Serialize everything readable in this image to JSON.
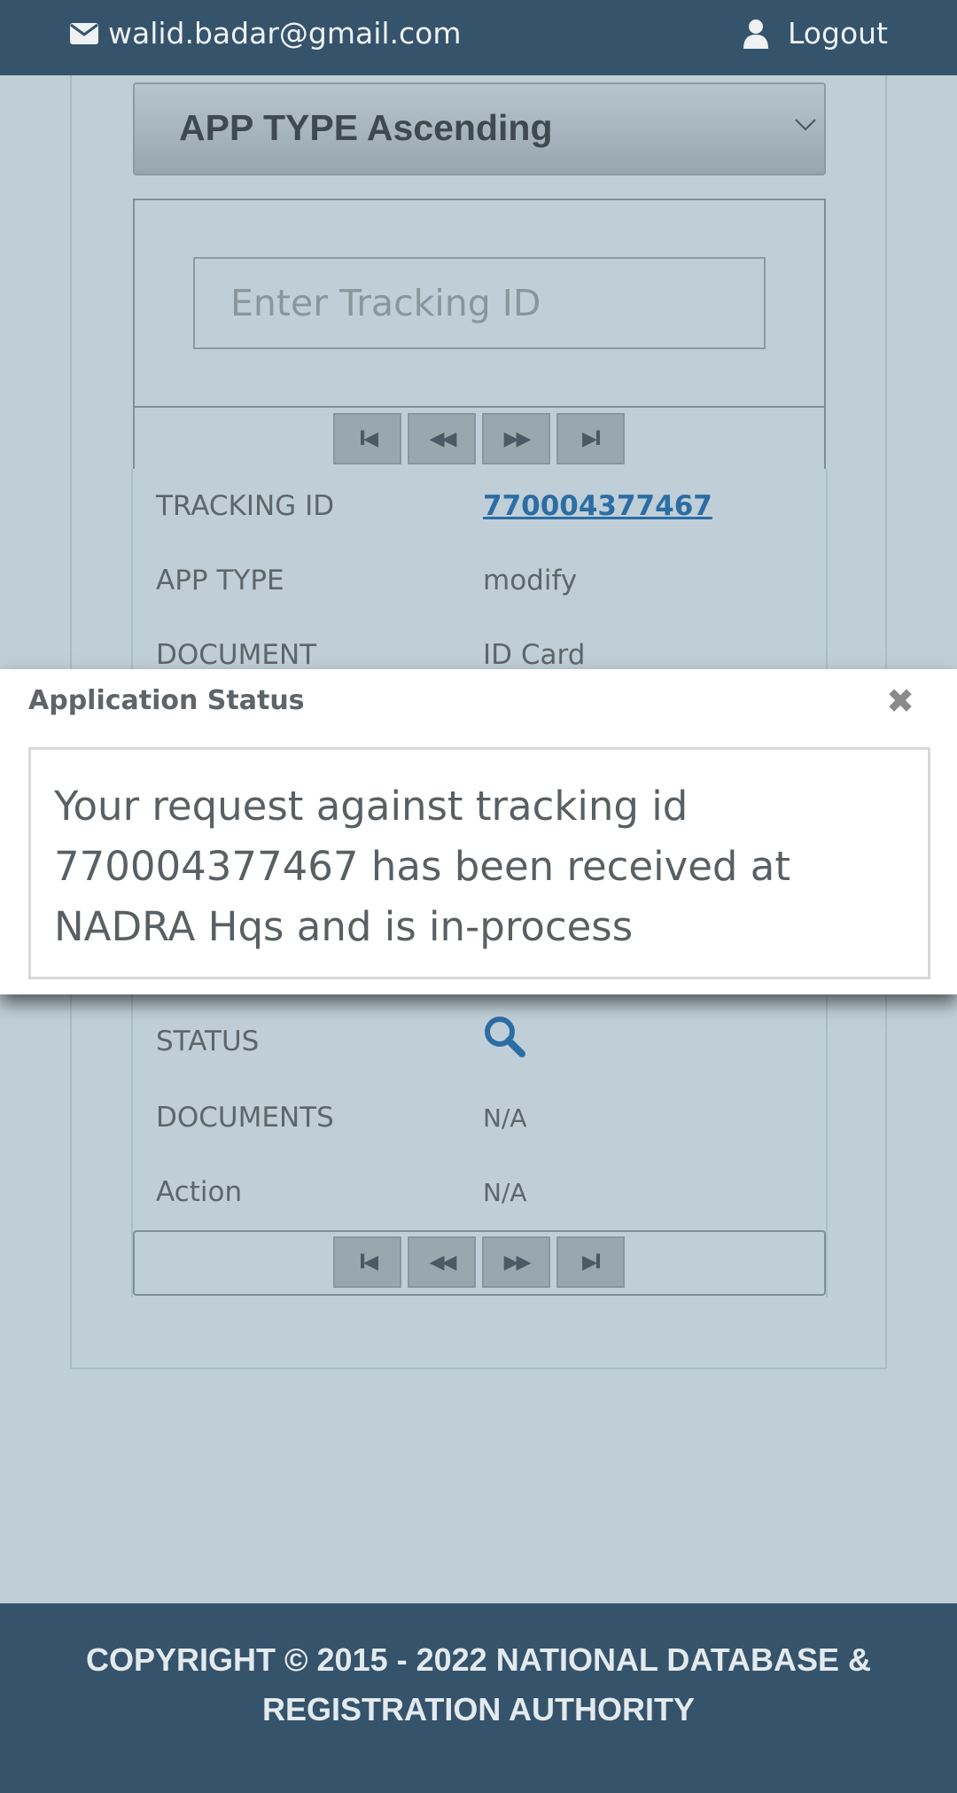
{
  "header": {
    "email": "walid.badar@gmail.com",
    "logout_label": "Logout"
  },
  "sort": {
    "selected": "APP TYPE Ascending"
  },
  "search": {
    "placeholder": "Enter Tracking ID"
  },
  "pager": {
    "first": "I◀",
    "prev": "◀◀",
    "next": "▶▶",
    "last": "▶I"
  },
  "details": {
    "tracking_id_label": "TRACKING ID",
    "tracking_id_value": "770004377467",
    "app_type_label": "APP TYPE",
    "app_type_value": "modify",
    "document_label": "DOCUMENT",
    "document_value": "ID Card",
    "status_label": "STATUS",
    "documents_label": "DOCUMENTS",
    "documents_value": "N/A",
    "action_label": "Action",
    "action_value": "N/A"
  },
  "modal": {
    "title": "Application Status",
    "close_symbol": "✖",
    "message": "Your request against tracking id 770004377467 has been received at NADRA Hqs and is in-process"
  },
  "footer": {
    "line1": "COPYRIGHT © 2015 - 2022 NATIONAL DATABASE &",
    "line2": "REGISTRATION AUTHORITY"
  },
  "colors": {
    "header_bg": "#35536b",
    "page_bg": "#c0cfd7",
    "link": "#2d6da5"
  }
}
